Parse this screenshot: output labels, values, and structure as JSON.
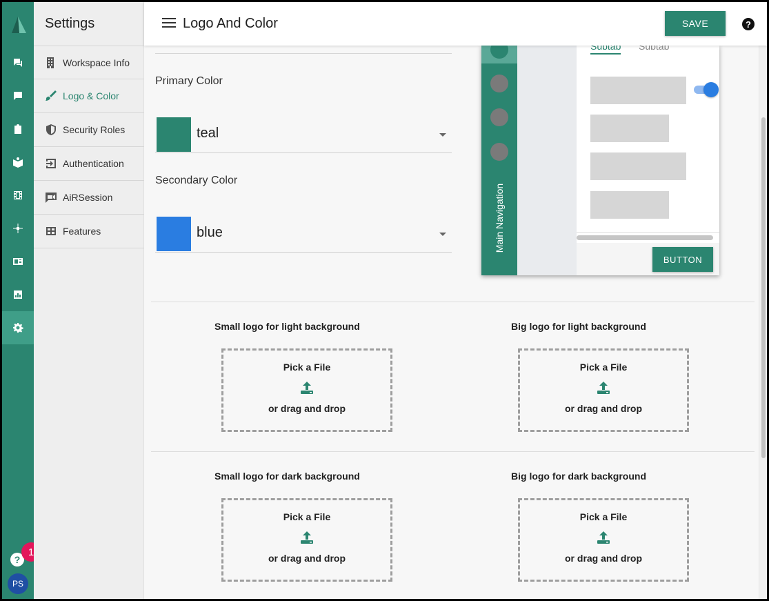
{
  "app": {
    "badge_count": "1",
    "avatar_initials": "PS"
  },
  "colors": {
    "brand": "#2b8570",
    "teal": "#2b8570",
    "blue": "#2a7de1",
    "badge": "#e3165b"
  },
  "rail": {
    "icons": [
      "chat-icon",
      "message-icon",
      "clipboard-icon",
      "book-icon",
      "film-icon",
      "sparkle-icon",
      "id-card-icon",
      "chart-icon",
      "gear-icon"
    ],
    "active": "gear-icon"
  },
  "settings": {
    "title": "Settings",
    "items": [
      {
        "label": "Workspace Info",
        "icon": "building-icon"
      },
      {
        "label": "Logo & Color",
        "icon": "brush-icon"
      },
      {
        "label": "Security Roles",
        "icon": "shield-icon"
      },
      {
        "label": "Authentication",
        "icon": "login-icon"
      },
      {
        "label": "AiRSession",
        "icon": "video-icon"
      },
      {
        "label": "Features",
        "icon": "features-icon"
      }
    ],
    "active_index": 1
  },
  "header": {
    "title": "Logo And Color",
    "save_label": "SAVE"
  },
  "colors_form": {
    "primary_label": "Primary Color",
    "primary_value": "teal",
    "secondary_label": "Secondary Color",
    "secondary_value": "blue"
  },
  "preview": {
    "nav_label": "Main Navigation",
    "tabs": [
      "Subtab",
      "Subtab"
    ],
    "button_label": "BUTTON"
  },
  "logos": [
    {
      "label": "Small logo for light background",
      "pick": "Pick a File",
      "drop": "or drag and drop"
    },
    {
      "label": "Big logo for light background",
      "pick": "Pick a File",
      "drop": "or drag and drop"
    },
    {
      "label": "Small logo for dark background",
      "pick": "Pick a File",
      "drop": "or drag and drop"
    },
    {
      "label": "Big logo for dark background",
      "pick": "Pick a File",
      "drop": "or drag and drop"
    }
  ]
}
